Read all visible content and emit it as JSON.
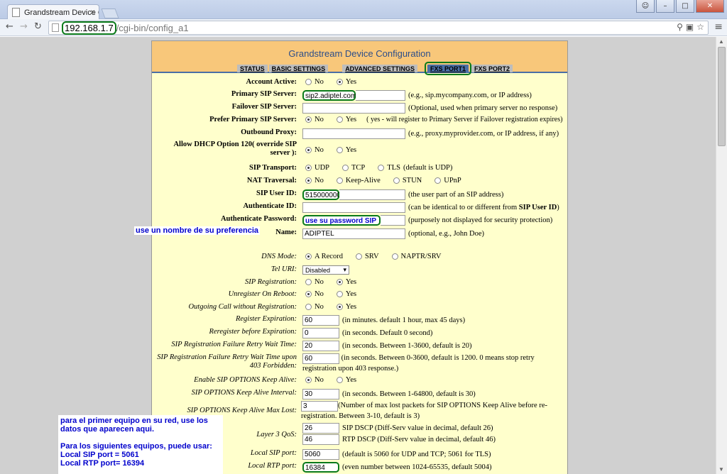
{
  "browser": {
    "tab_title": "Grandstream Device Configu",
    "url_host": "192.168.1.7",
    "url_path": "/cgi-bin/config_a1"
  },
  "page": {
    "title": "Grandstream Device Configuration",
    "nav": [
      "STATUS",
      "BASIC SETTINGS",
      "ADVANCED SETTINGS",
      "FXS PORT1",
      "FXS PORT2"
    ],
    "active_nav": "FXS PORT1"
  },
  "fields": {
    "account_active": {
      "label": "Account Active:",
      "opts": [
        "No",
        "Yes"
      ],
      "selected": "Yes"
    },
    "primary_sip": {
      "label": "Primary SIP Server:",
      "value": "sip2.adiptel.com",
      "hint": "(e.g., sip.mycompany.com, or IP address)"
    },
    "failover_sip": {
      "label": "Failover SIP Server:",
      "value": "",
      "hint": "(Optional, used when primary server no response)"
    },
    "prefer_primary": {
      "label": "Prefer Primary SIP Server:",
      "opts": [
        "No",
        "Yes"
      ],
      "selected": "No",
      "hint": "( yes - will register to Primary Server if Failover registration expires)"
    },
    "outbound_proxy": {
      "label": "Outbound Proxy:",
      "value": "",
      "hint": "(e.g., proxy.myprovider.com, or IP address, if any)"
    },
    "dhcp120": {
      "label": "Allow DHCP Option 120( override SIP server ):",
      "opts": [
        "No",
        "Yes"
      ],
      "selected": "No"
    },
    "sip_transport": {
      "label": "SIP Transport:",
      "opts": [
        "UDP",
        "TCP",
        "TLS"
      ],
      "selected": "UDP",
      "hint": "(default is UDP)"
    },
    "nat": {
      "label": "NAT Traversal:",
      "opts": [
        "No",
        "Keep-Alive",
        "STUN",
        "UPnP"
      ],
      "selected": "No"
    },
    "sip_user_id": {
      "label": "SIP User ID:",
      "value": "515000000",
      "hint": "(the user part of an SIP address)"
    },
    "auth_id": {
      "label": "Authenticate ID:",
      "value": "",
      "hint_a": "(can be identical to or different from ",
      "hint_b": "SIP User ID",
      "hint_c": ")"
    },
    "auth_pwd": {
      "label": "Authenticate Password:",
      "value": "use su password SIP",
      "hint": "(purposely not displayed for security protection)"
    },
    "name": {
      "label": "Name:",
      "value": "ADIPTEL",
      "hint": "(optional, e.g., John Doe)"
    },
    "dns_mode": {
      "label": "DNS Mode:",
      "opts": [
        "A Record",
        "SRV",
        "NAPTR/SRV"
      ],
      "selected": "A Record"
    },
    "tel_uri": {
      "label": "Tel URI:",
      "value": "Disabled"
    },
    "sip_reg": {
      "label": "SIP Registration:",
      "opts": [
        "No",
        "Yes"
      ],
      "selected": "Yes"
    },
    "unreg_reboot": {
      "label": "Unregister On Reboot:",
      "opts": [
        "No",
        "Yes"
      ],
      "selected": "No"
    },
    "outgoing_noreg": {
      "label": "Outgoing Call without Registration:",
      "opts": [
        "No",
        "Yes"
      ],
      "selected": "Yes"
    },
    "reg_exp": {
      "label": "Register Expiration:",
      "value": "60",
      "hint": "(in minutes. default 1 hour, max 45 days)"
    },
    "rereg": {
      "label": "Reregister before Expiration:",
      "value": "0",
      "hint": "(in seconds. Default 0 second)"
    },
    "reg_fail_retry": {
      "label": "SIP Registration Failure Retry Wait Time:",
      "value": "20",
      "hint": "(in seconds. Between 1-3600, default is 20)"
    },
    "reg_fail_403": {
      "label": "SIP Registration Failure Retry Wait Time upon 403 Forbidden:",
      "value": "60",
      "hint": "(in seconds. Between 0-3600, default is 1200. 0 means stop retry registration upon 403 response.)"
    },
    "options_ka": {
      "label": "Enable SIP OPTIONS Keep Alive:",
      "opts": [
        "No",
        "Yes"
      ],
      "selected": "No"
    },
    "options_interval": {
      "label": "SIP OPTIONS Keep Alive Interval:",
      "value": "30",
      "hint": "(in seconds. Between 1-64800, default is 30)"
    },
    "options_max_lost": {
      "label": "SIP OPTIONS Keep Alive Max Lost:",
      "value": "3",
      "hint": "(Number of max lost packets for SIP OPTIONS Keep Alive before re-registration. Between 3-10, default is 3)"
    },
    "qos": {
      "label": "Layer 3 QoS:",
      "sip_value": "26",
      "sip_hint": "SIP DSCP (Diff-Serv value in decimal, default 26)",
      "rtp_value": "46",
      "rtp_hint": "RTP DSCP (Diff-Serv value in decimal, default 46)"
    },
    "local_sip_port": {
      "label": "Local SIP port:",
      "value": "5060",
      "hint": "(default is 5060 for UDP and TCP; 5061 for TLS)"
    },
    "local_rtp_port": {
      "label": "Local RTP port:",
      "value": "16384",
      "hint": "(even number between 1024-65535, default 5004)"
    }
  },
  "annotations": {
    "name_note": "use un nombre de su preferencia",
    "box_line1": "para el primer equipo en su red, use los datos que aparecen aqui.",
    "box_line2": "Para los siguientes equipos, puede usar:",
    "box_line3": "Local SIP port = 5061",
    "box_line4": "Local RTP port= 16394"
  },
  "colors": {
    "panel_bg": "#ffffcc",
    "header_bg": "#f8c77a",
    "highlight": "#0a7a1a",
    "annotation": "#0000cc"
  }
}
